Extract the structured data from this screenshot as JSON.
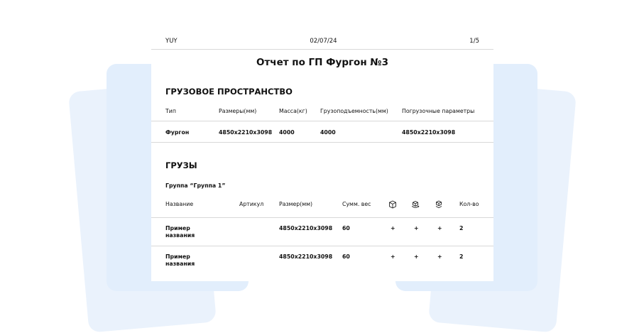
{
  "header": {
    "left": "YUY",
    "date": "02/07/24",
    "page": "1/5"
  },
  "title": "Отчет по ГП Фургон №3",
  "cargo_space": {
    "section_title": "ГРУЗОВОЕ ПРОСТРАНСТВО",
    "columns": [
      "Тип",
      "Размеры(мм)",
      "Масса(кг)",
      "Грузоподъемность(мм)",
      "Погрузочные параметры"
    ],
    "row": [
      "Фургон",
      "4850x2210x3098",
      "4000",
      "4000",
      "4850x2210x3098"
    ]
  },
  "cargo": {
    "section_title": "ГРУЗЫ",
    "group_title": "Группа “Группа 1”",
    "columns": {
      "name": "Название",
      "article": "Артикул",
      "size": "Размер(мм)",
      "weight": "Сумм. вес",
      "qty": "Кол-во"
    },
    "column_icons": [
      "box-icon",
      "box-rotate-icon",
      "box-stack-icon"
    ],
    "rows": [
      {
        "name_1": "Пример",
        "name_2": "названия",
        "size": "4850x2210x3098",
        "weight": "60",
        "f1": "+",
        "f2": "+",
        "f3": "+",
        "qty": "2"
      },
      {
        "name_1": "Пример",
        "name_2": "названия",
        "size": "4850x2210x3098",
        "weight": "60",
        "f1": "+",
        "f2": "+",
        "f3": "+",
        "qty": "2"
      }
    ]
  }
}
